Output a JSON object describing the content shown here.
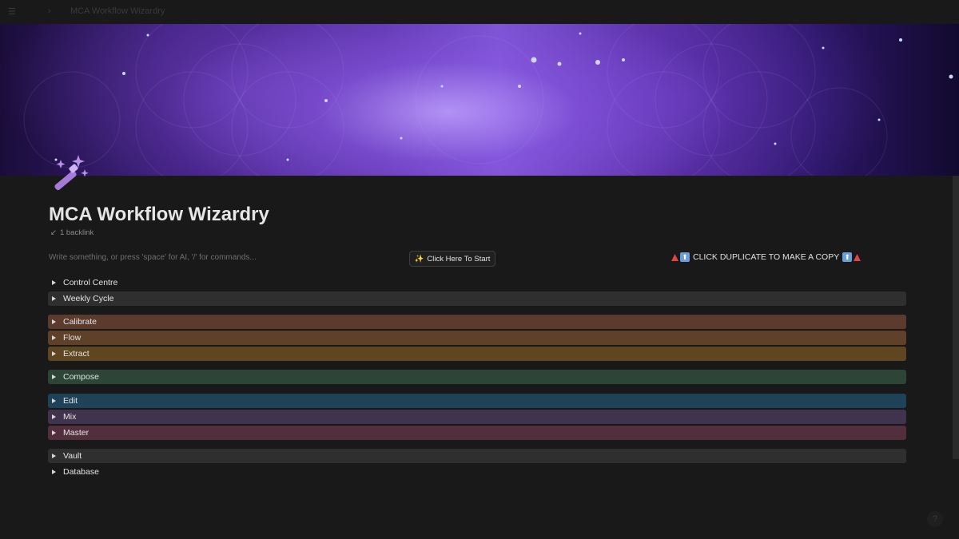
{
  "breadcrumb": {
    "title": "MCA Workflow Wizardry"
  },
  "page": {
    "title": "MCA Workflow Wizardry",
    "backlink": "1 backlink",
    "placeholder": "Write something, or press 'space' for AI, '/' for commands...",
    "start_button": "Click Here To Start",
    "duplicate_notice": "CLICK DUPLICATE TO MAKE A COPY"
  },
  "toggles": [
    {
      "label": "Control Centre",
      "color": "#191919"
    },
    {
      "label": "Weekly Cycle",
      "color": "#2f2f2f"
    },
    {
      "label": "Calibrate",
      "color": "#5c3b2f"
    },
    {
      "label": "Flow",
      "color": "#5e4128"
    },
    {
      "label": "Extract",
      "color": "#5d4620"
    },
    {
      "label": "Compose",
      "color": "#2c4536"
    },
    {
      "label": "Edit",
      "color": "#1e4257"
    },
    {
      "label": "Mix",
      "color": "#41324e"
    },
    {
      "label": "Master",
      "color": "#522f3d"
    },
    {
      "label": "Vault",
      "color": "#2f2f2f"
    },
    {
      "label": "Database",
      "color": "#191919"
    }
  ],
  "help": {
    "label": "?"
  }
}
